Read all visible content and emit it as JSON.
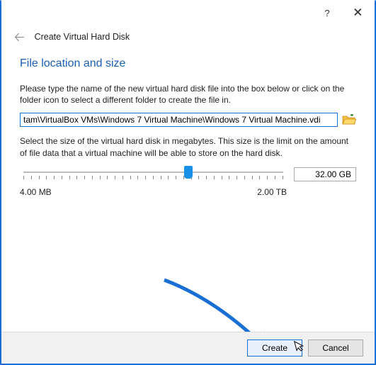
{
  "titlebar": {
    "help": "?",
    "close": "🗙"
  },
  "header": {
    "title": "Create Virtual Hard Disk"
  },
  "section": {
    "title": "File location and size"
  },
  "desc1": "Please type the name of the new virtual hard disk file into the box below or click on the folder icon to select a different folder to create the file in.",
  "path": {
    "value": "tam\\VirtualBox VMs\\Windows 7 Virtual Machine\\Windows 7 Virtual Machine.vdi"
  },
  "desc2": "Select the size of the virtual hard disk in megabytes. This size is the limit on the amount of file data that a virtual machine will be able to store on the hard disk.",
  "size": {
    "value": "32.00 GB",
    "min_label": "4.00 MB",
    "max_label": "2.00 TB"
  },
  "footer": {
    "create": "Create",
    "cancel": "Cancel"
  }
}
